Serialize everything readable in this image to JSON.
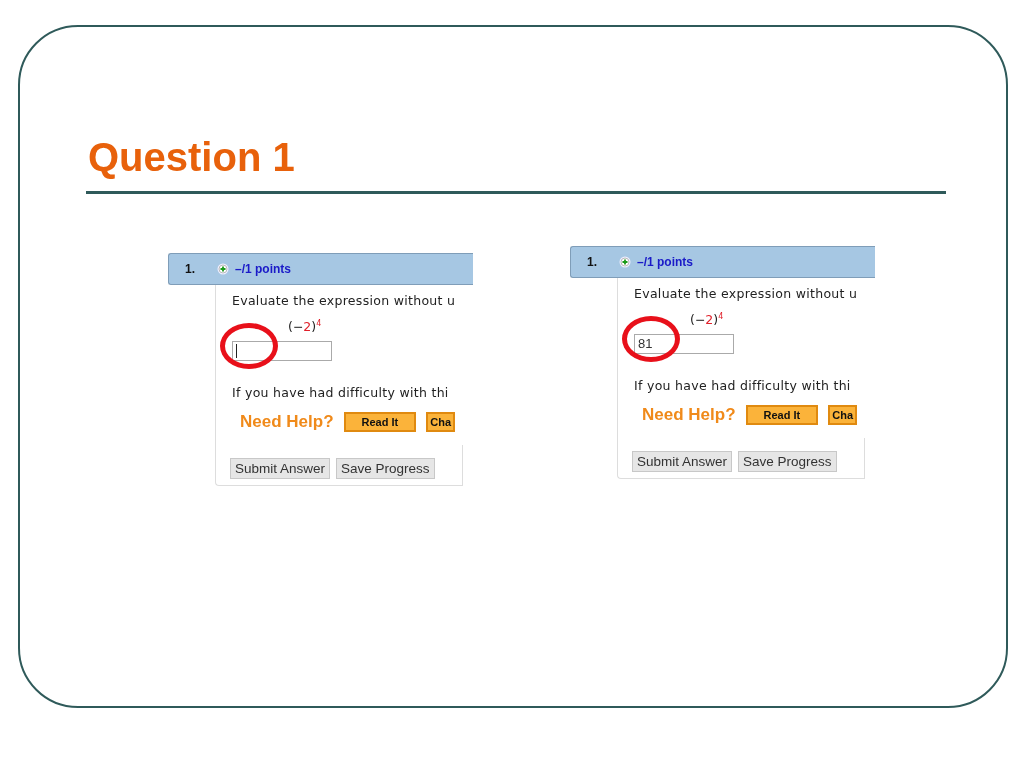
{
  "slide": {
    "title": "Question 1"
  },
  "panels": [
    {
      "number": "1.",
      "points": "–/1 points",
      "prompt": "Evaluate the expression without u",
      "expression": {
        "open": "(−",
        "base": "2",
        "close": ")",
        "exponent": "4"
      },
      "answer": {
        "focused": true,
        "highlighted": true
      },
      "help_text": "If you have had difficulty with thi",
      "need_help": "Need Help?",
      "help_buttons": [
        "Read It",
        "Cha"
      ],
      "buttons": [
        "Submit Answer",
        "Save Progress"
      ]
    },
    {
      "number": "1.",
      "points": "–/1 points",
      "prompt": "Evaluate the expression without u",
      "expression": {
        "open": "(−",
        "base": "2",
        "close": ")",
        "exponent": "4"
      },
      "answer": {
        "value": "81",
        "focused": false,
        "highlighted": true
      },
      "help_text": "If you have had difficulty with thi",
      "need_help": "Need Help?",
      "help_buttons": [
        "Read It",
        "Cha"
      ],
      "buttons": [
        "Submit Answer",
        "Save Progress"
      ]
    }
  ]
}
